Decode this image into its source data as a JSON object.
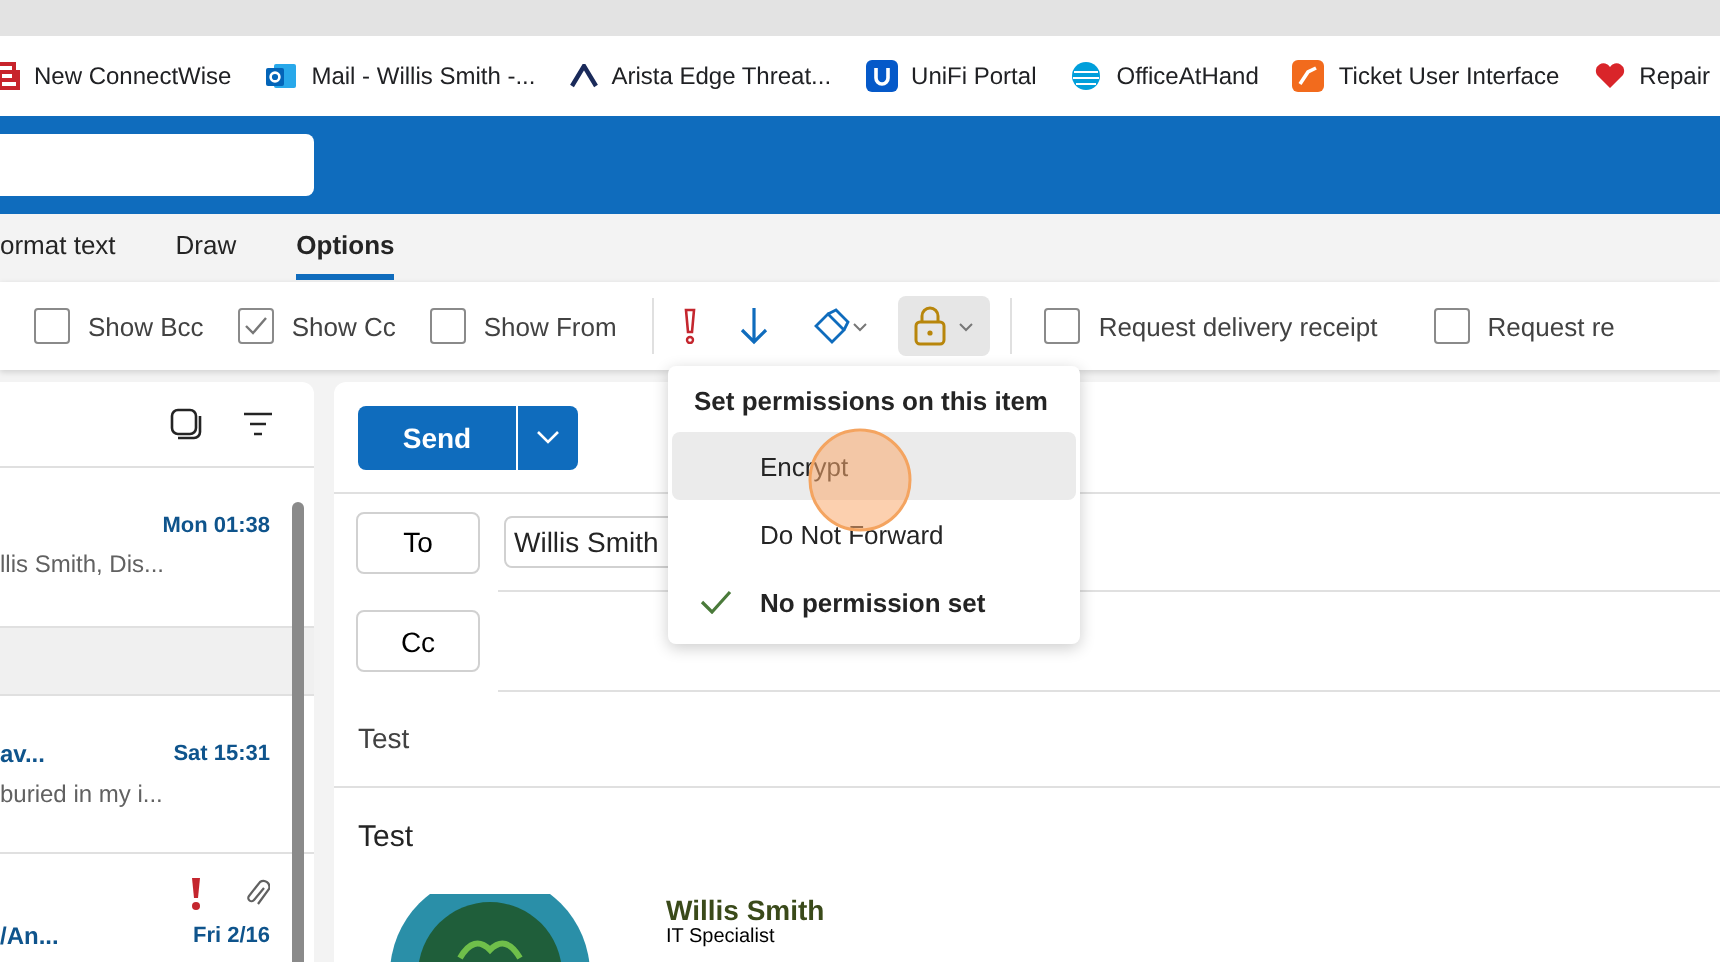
{
  "bookmarks": [
    {
      "label": "New ConnectWise"
    },
    {
      "label": "Mail - Willis Smith -..."
    },
    {
      "label": "Arista Edge Threat..."
    },
    {
      "label": "UniFi Portal"
    },
    {
      "label": "OfficeAtHand"
    },
    {
      "label": "Ticket User Interface"
    },
    {
      "label": "Repair"
    }
  ],
  "ribbon_tabs": [
    {
      "label": "ormat text",
      "selected": false
    },
    {
      "label": "Draw",
      "selected": false
    },
    {
      "label": "Options",
      "selected": true
    }
  ],
  "toolbar": {
    "show_options": [
      {
        "label": "Show Bcc",
        "checked": false
      },
      {
        "label": "Show Cc",
        "checked": true
      },
      {
        "label": "Show From",
        "checked": false
      }
    ],
    "receipts": [
      {
        "label": "Request delivery receipt",
        "checked": false
      },
      {
        "label": "Request re",
        "checked": false
      }
    ]
  },
  "messages": [
    {
      "time": "Mon 01:38",
      "preview": "llis Smith, Dis...",
      "important": false,
      "attachment": false
    },
    {
      "subject": "av...",
      "time": "Sat 15:31",
      "preview": "buried in my i...",
      "important": false,
      "attachment": false
    },
    {
      "subject": "/An...",
      "time": "Fri 2/16",
      "important": true,
      "attachment": true
    }
  ],
  "compose": {
    "send": "Send",
    "to_label": "To",
    "recipient": "Willis Smith",
    "cc_label": "Cc",
    "subject": "Test",
    "body": "Test",
    "signature": {
      "name": "Willis Smith",
      "title": "IT Specialist"
    }
  },
  "permissions_menu": {
    "title": "Set permissions on this item",
    "items": [
      {
        "label": "Encrypt",
        "selected": false,
        "highlighted": true
      },
      {
        "label": "Do Not Forward",
        "selected": false,
        "highlighted": false
      },
      {
        "label": "No permission set",
        "selected": true,
        "highlighted": false
      }
    ]
  }
}
